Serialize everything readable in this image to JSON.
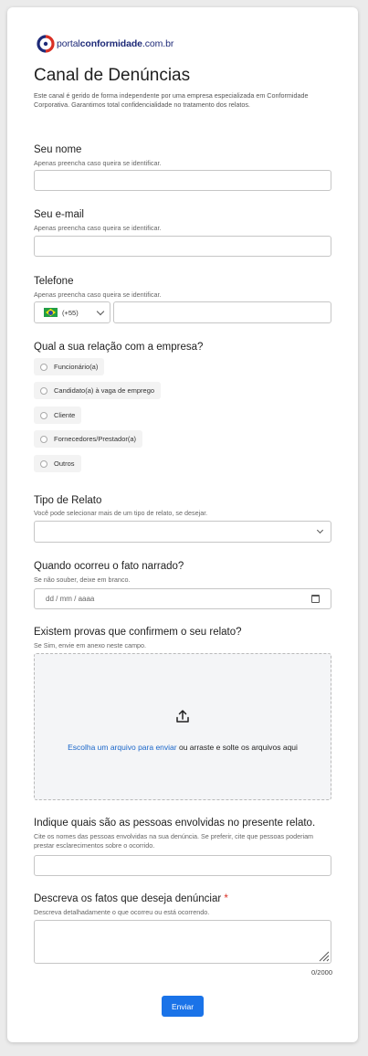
{
  "logo": {
    "prefix": "portal",
    "bold": "conformidade",
    "suffix": ".com.br",
    "color": "#1e2a78",
    "accent": "#d93025"
  },
  "page": {
    "title": "Canal de Denúncias",
    "intro": "Este canal é gerido de forma independente por uma empresa especializada em Conformidade Corporativa. Garantimos total confidencialidade no tratamento dos relatos."
  },
  "fields": {
    "nome": {
      "label": "Seu nome",
      "help": "Apenas preencha caso queira se identificar.",
      "value": ""
    },
    "email": {
      "label": "Seu e-mail",
      "help": "Apenas preencha caso queira se identificar.",
      "value": ""
    },
    "telefone": {
      "label": "Telefone",
      "help": "Apenas preencha caso queira se identificar.",
      "country_code": "(+55)",
      "country_flag": "brazil-flag-icon",
      "value": ""
    },
    "relacao": {
      "label": "Qual a sua relação com a empresa?",
      "options": [
        "Funcionário(a)",
        "Candidato(a) à vaga de emprego",
        "Cliente",
        "Fornecedores/Prestador(a)",
        "Outros"
      ],
      "selected": null
    },
    "tipo": {
      "label": "Tipo de Relato",
      "help": "Você pode selecionar mais de um tipo de relato, se desejar.",
      "value": ""
    },
    "quando": {
      "label": "Quando ocorreu o fato narrado?",
      "help": "Se não souber, deixe em branco.",
      "placeholder": "dd / mm / aaaa"
    },
    "provas": {
      "label": "Existem provas que confirmem o seu relato?",
      "help": "Se Sim, envie em anexo neste campo.",
      "link_text": "Escolha um arquivo para enviar",
      "rest_text": " ou arraste e solte os arquivos aqui"
    },
    "pessoas": {
      "label": "Indique quais são as pessoas envolvidas no presente relato.",
      "help": "Cite os nomes das pessoas envolvidas na sua denúncia. Se preferir, cite que pessoas poderiam prestar esclarecimentos sobre o ocorrido.",
      "value": ""
    },
    "fatos": {
      "label": "Descreva os fatos que deseja denúnciar",
      "required_mark": "*",
      "help": "Descreva detalhadamente o que ocorreu ou está ocorrendo.",
      "value": "",
      "counter": "0/2000"
    }
  },
  "submit": {
    "label": "Enviar",
    "color": "#1a73e8"
  }
}
